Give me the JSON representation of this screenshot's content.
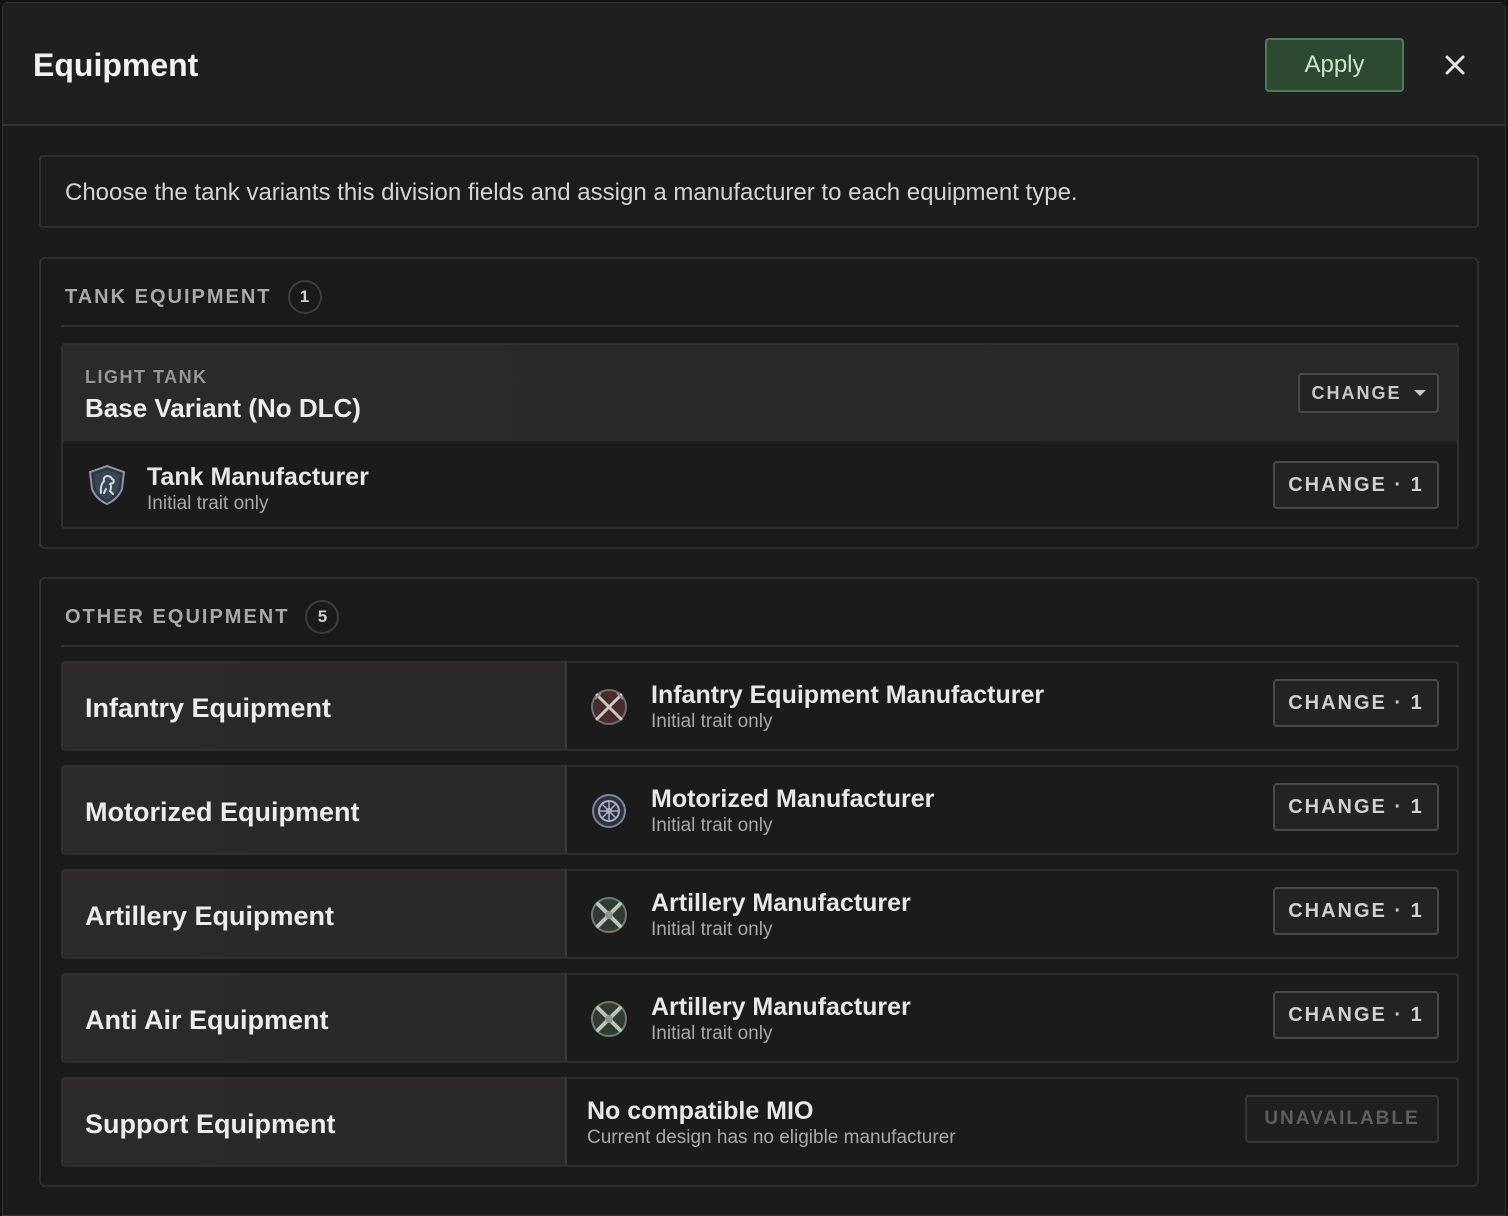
{
  "header": {
    "title": "Equipment",
    "apply_label": "Apply",
    "close_icon": "close-icon"
  },
  "info": {
    "text": "Choose the tank variants this division fields and assign a manufacturer to each equipment type."
  },
  "tank_section": {
    "title": "TANK EQUIPMENT",
    "count": "1",
    "card": {
      "type_label": "LIGHT TANK",
      "variant": "Base Variant (No DLC)",
      "variant_change_label": "CHANGE",
      "manufacturer": {
        "icon": "shield-lion-icon",
        "name": "Tank Manufacturer",
        "subtitle": "Initial trait only",
        "change_label": "CHANGE · 1"
      }
    }
  },
  "other_section": {
    "title": "OTHER EQUIPMENT",
    "count": "5",
    "rows": [
      {
        "label": "Infantry Equipment",
        "icon": "crossed-swords-icon",
        "mfr_name": "Infantry Equipment Manufacturer",
        "mfr_sub": "Initial trait only",
        "action": "CHANGE · 1"
      },
      {
        "label": "Motorized Equipment",
        "icon": "wheel-icon",
        "mfr_name": "Motorized Manufacturer",
        "mfr_sub": "Initial trait only",
        "action": "CHANGE · 1"
      },
      {
        "label": "Artillery Equipment",
        "icon": "crossed-cannons-icon",
        "mfr_name": "Artillery Manufacturer",
        "mfr_sub": "Initial trait only",
        "action": "CHANGE · 1"
      },
      {
        "label": "Anti Air Equipment",
        "icon": "crossed-cannons-icon",
        "mfr_name": "Artillery Manufacturer",
        "mfr_sub": "Initial trait only",
        "action": "CHANGE · 1"
      },
      {
        "label": "Support Equipment",
        "icon": "",
        "mfr_name": "No compatible MIO",
        "mfr_sub": "Current design has no eligible manufacturer",
        "action": "UNAVAILABLE"
      }
    ]
  }
}
